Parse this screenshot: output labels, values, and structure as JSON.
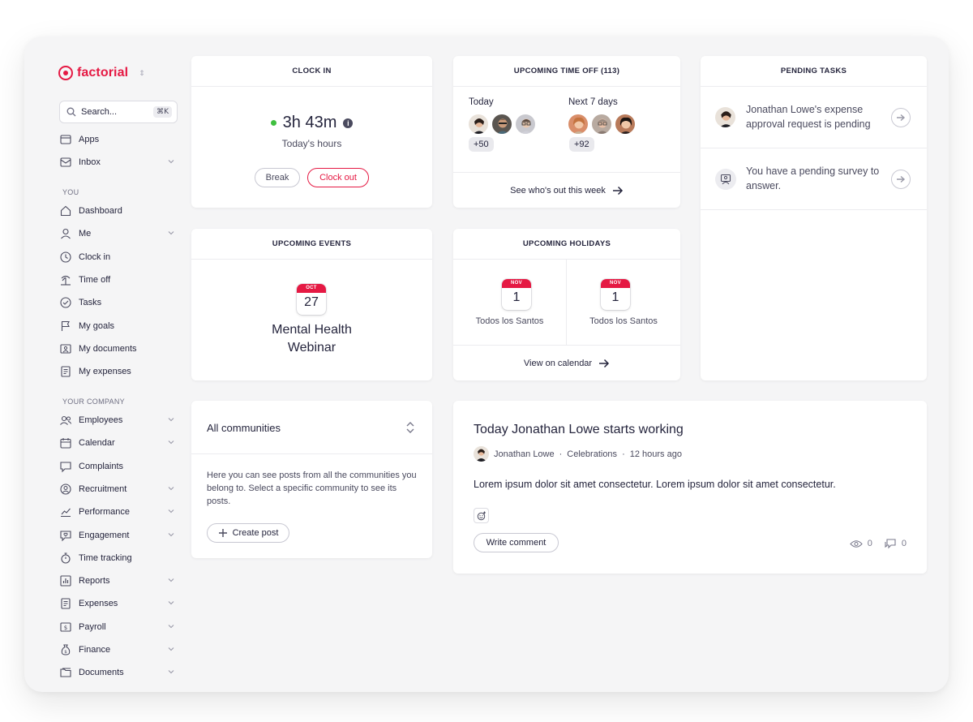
{
  "brand": {
    "name": "factorial",
    "color": "#e51943"
  },
  "search": {
    "label": "Search...",
    "shortcut": "⌘K"
  },
  "sidebar": {
    "top_items": [
      {
        "label": "Apps",
        "icon": "apps-icon"
      },
      {
        "label": "Inbox",
        "icon": "inbox-icon",
        "expandable": true
      }
    ],
    "you_label": "YOU",
    "you_items": [
      {
        "label": "Dashboard",
        "icon": "home-icon"
      },
      {
        "label": "Me",
        "icon": "user-icon",
        "expandable": true
      },
      {
        "label": "Clock in",
        "icon": "clock-icon"
      },
      {
        "label": "Time off",
        "icon": "palm-tree-icon"
      },
      {
        "label": "Tasks",
        "icon": "check-circle-icon"
      },
      {
        "label": "My goals",
        "icon": "flag-icon"
      },
      {
        "label": "My documents",
        "icon": "folder-user-icon"
      },
      {
        "label": "My expenses",
        "icon": "receipt-icon"
      }
    ],
    "company_label": "YOUR COMPANY",
    "company_items": [
      {
        "label": "Employees",
        "icon": "people-icon",
        "expandable": true
      },
      {
        "label": "Calendar",
        "icon": "calendar-icon",
        "expandable": true
      },
      {
        "label": "Complaints",
        "icon": "chat-bubble-icon"
      },
      {
        "label": "Recruitment",
        "icon": "recruitment-icon",
        "expandable": true
      },
      {
        "label": "Performance",
        "icon": "chart-line-icon",
        "expandable": true
      },
      {
        "label": "Engagement",
        "icon": "heart-bubble-icon",
        "expandable": true
      },
      {
        "label": "Time tracking",
        "icon": "stopwatch-icon"
      },
      {
        "label": "Reports",
        "icon": "bar-chart-icon",
        "expandable": true
      },
      {
        "label": "Expenses",
        "icon": "receipt-icon",
        "expandable": true
      },
      {
        "label": "Payroll",
        "icon": "money-icon",
        "expandable": true
      },
      {
        "label": "Finance",
        "icon": "money-bag-icon",
        "expandable": true
      },
      {
        "label": "Documents",
        "icon": "folders-icon",
        "expandable": true
      }
    ]
  },
  "clock_in": {
    "title": "CLOCK IN",
    "time": "3h 43m",
    "subtitle": "Today's hours",
    "status_color": "#3fbf3f",
    "break_label": "Break",
    "clock_out_label": "Clock out"
  },
  "time_off": {
    "title": "UPCOMING TIME OFF (113)",
    "today_label": "Today",
    "today_count": "+50",
    "next_label": "Next 7 days",
    "next_count": "+92",
    "link": "See who's out this week"
  },
  "pending_tasks": {
    "title": "PENDING TASKS",
    "tasks": [
      {
        "text": "Jonathan Lowe's expense approval request is pending"
      },
      {
        "text": "You have a pending survey to answer."
      }
    ]
  },
  "events": {
    "title": "UPCOMING EVENTS",
    "month": "OCT",
    "day": "27",
    "name": "Mental Health Webinar"
  },
  "holidays": {
    "title": "UPCOMING HOLIDAYS",
    "items": [
      {
        "month": "NOV",
        "day": "1",
        "name": "Todos los Santos"
      },
      {
        "month": "NOV",
        "day": "1",
        "name": "Todos los Santos"
      }
    ],
    "link": "View on calendar"
  },
  "communities": {
    "selector": "All communities",
    "description": "Here you can see posts from all the communities you belong to. Select a specific community to see its posts.",
    "create_label": "Create post"
  },
  "post": {
    "title": "Today Jonathan Lowe starts working",
    "author": "Jonathan Lowe",
    "community": "Celebrations",
    "time": "12 hours ago",
    "body": "Lorem ipsum dolor sit amet consectetur. Lorem ipsum dolor sit amet consectetur.",
    "comment_label": "Write comment",
    "views": "0",
    "comments": "0"
  }
}
